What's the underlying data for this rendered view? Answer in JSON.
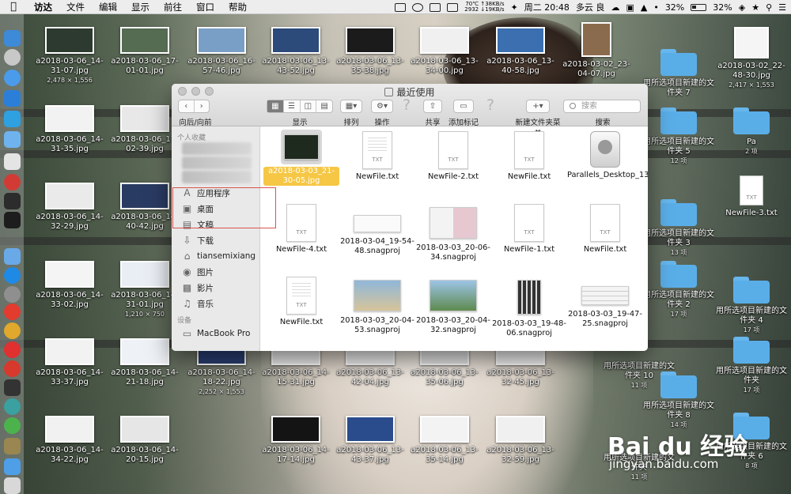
{
  "menubar": {
    "app": "访达",
    "menus": [
      "文件",
      "编辑",
      "显示",
      "前往",
      "窗口",
      "帮助"
    ],
    "net_up": "70℃ ↑38KB/s",
    "net_down": "2932 ↓19KB/s",
    "clock": "周二 20:48",
    "weather": "多云 良",
    "battery_pct_1": "32%",
    "battery_pct_2": "32%"
  },
  "finder": {
    "title": "最近使用",
    "toolbar": {
      "nav_label": "向后/向前",
      "view_label": "显示",
      "sort_label": "排列",
      "action_label": "操作",
      "share_label": "共享",
      "tags_label": "添加标记",
      "newfolder_label": "新建文件夹菜单",
      "search_label": "搜索",
      "search_placeholder": "搜索"
    },
    "sidebar": {
      "favorites_header": "个人收藏",
      "devices_header": "设备",
      "items": [
        "应用程序",
        "桌面",
        "文稿",
        "下载",
        "tiansemixiang",
        "图片",
        "影片",
        "音乐"
      ],
      "device": "MacBook Pro"
    },
    "files": [
      {
        "name": "a2018-03-03_21-30-05.jpg",
        "kind": "image",
        "selected": true
      },
      {
        "name": "NewFile.txt",
        "kind": "txt"
      },
      {
        "name": "NewFile-2.txt",
        "kind": "txt"
      },
      {
        "name": "NewFile.txt",
        "kind": "txt"
      },
      {
        "name": "Parallels_Desktop_13.2.0_...T...dmg",
        "kind": "dmg"
      },
      {
        "name": "NewFile-4.txt",
        "kind": "txt"
      },
      {
        "name": "2018-03-04_19-54-48.snagproj",
        "kind": "image"
      },
      {
        "name": "2018-03-03_20-06-34.snagproj",
        "kind": "image"
      },
      {
        "name": "NewFile-1.txt",
        "kind": "txt"
      },
      {
        "name": "NewFile.txt",
        "kind": "txt"
      },
      {
        "name": "NewFile.txt",
        "kind": "txt"
      },
      {
        "name": "2018-03-03_20-04-53.snagproj",
        "kind": "image"
      },
      {
        "name": "2018-03-03_20-04-32.snagproj",
        "kind": "image"
      },
      {
        "name": "2018-03-03_19-48-06.snagproj",
        "kind": "image"
      },
      {
        "name": "2018-03-03_19-47-25.snagproj",
        "kind": "image"
      }
    ]
  },
  "desktop": {
    "left_icons": [
      {
        "name": "a2018-03-06_14-31-07.jpg",
        "sub": "2,478 × 1,556"
      },
      {
        "name": "a2018-03-06_17-01-01.jpg",
        "sub": ""
      },
      {
        "name": "a2018-03-06_14-31-35.jpg",
        "sub": ""
      },
      {
        "name": "a2018-03-06_17-02-39.jpg",
        "sub": ""
      },
      {
        "name": "a2018-03-06_14-32-29.jpg",
        "sub": ""
      },
      {
        "name": "a2018-03-06_14-40-42.jpg",
        "sub": ""
      },
      {
        "name": "a2018-03-06_14-33-02.jpg",
        "sub": ""
      },
      {
        "name": "a2018-03-06_14-31-01.jpg",
        "sub": "1,210 × 750"
      },
      {
        "name": "a2018-03-06_14-33-37.jpg",
        "sub": ""
      },
      {
        "name": "a2018-03-06_14-21-18.jpg",
        "sub": ""
      },
      {
        "name": "a2018-03-06_14-34-22.jpg",
        "sub": ""
      },
      {
        "name": "a2018-03-06_14-20-15.jpg",
        "sub": ""
      }
    ],
    "top_icons": [
      {
        "name": "a2018-03-06_16-57-46.jpg"
      },
      {
        "name": "a2018-03-06_13-43-52.jpg"
      },
      {
        "name": "a2018-03-06_13-35-38.jpg"
      },
      {
        "name": "a2018-03-06_13-34-00.jpg"
      },
      {
        "name": "a2018-03-06_13-40-58.jpg"
      },
      {
        "name": "a2018-03-02_23-04-07.jpg"
      }
    ],
    "bottom_icons": [
      {
        "name": "a2018-03-06_14-18-22.jpg",
        "sub": "2,252 × 1,553"
      },
      {
        "name": "a2018-03-06_14-15-31.jpg",
        "sub": ""
      },
      {
        "name": "a2018-03-06_13-42-04.jpg",
        "sub": ""
      },
      {
        "name": "a2018-03-06_13-35-06.jpg",
        "sub": ""
      },
      {
        "name": "a2018-03-06_13-32-45.jpg",
        "sub": ""
      },
      {
        "name": "a2018-03-06_14-17-14.jpg",
        "sub": ""
      },
      {
        "name": "a2018-03-06_13-43-37.jpg",
        "sub": ""
      },
      {
        "name": "a2018-03-06_13-35-14.jpg",
        "sub": ""
      },
      {
        "name": "a2018-03-06_13-32-59.jpg",
        "sub": ""
      }
    ],
    "right_folders": [
      {
        "name": "用所选项目新建的文件夹 7",
        "sub": ""
      },
      {
        "name": "用所选项目新建的文件夹 5",
        "sub": "12 项"
      },
      {
        "name": "Pa",
        "sub": "2 项"
      },
      {
        "name": "用所选项目新建的文件夹 3",
        "sub": "13 项"
      },
      {
        "name": "用所选项目新建的文件夹 2",
        "sub": "17 项"
      },
      {
        "name": "用所选项目新建的文件夹 4",
        "sub": "17 项"
      },
      {
        "name": "用所选项目新建的文件夹 10",
        "sub": "11 项"
      },
      {
        "name": "用所选项目新建的文件夹",
        "sub": "17 项"
      },
      {
        "name": "用所选项目新建的文件夹 8",
        "sub": "14 项"
      },
      {
        "name": "用所选项目新建的文件夹 6",
        "sub": "8 项"
      },
      {
        "name": "用所选项目新建的文件夹",
        "sub": "11 项"
      }
    ],
    "top_right": {
      "name": "a2018-03-02_22-48-30.jpg",
      "sub": "2,417 × 1,553"
    },
    "right_txt": {
      "name": "NewFile-3.txt"
    },
    "watermark": "Bai du 经验",
    "watermark_url": "jingyan.baidu.com"
  },
  "colors": {
    "selection_blue": "#2f6fd6",
    "selection_yellow": "#f6c744",
    "highlight_red": "#d9534f",
    "folder_blue": "#5aaee8"
  }
}
